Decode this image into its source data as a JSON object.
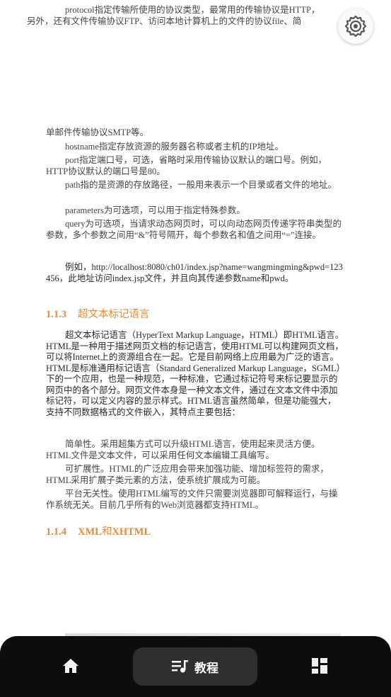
{
  "paragraphs": {
    "protocol_line1": "protocol指定传输所使用的协议类型，最常用的传输协议是HTTP，",
    "protocol_line2": "另外，还有文件传输协议FTP、访问本地计算机上的文件的协议file、简",
    "smtp": "单邮件传输协议SMTP等。",
    "hostname": "hostname指定存放资源的服务器名称或者主机的IP地址。",
    "port": "port指定端口号，可选，省略时采用传输协议默认的端口号。例如，HTTP协议默认的端口号是80。",
    "path": "path指的是资源的存放路径，一般用来表示一个目录或者文件的地址。",
    "parameters": "parameters为可选项，可以用于指定特殊参数。",
    "query": "query为可选项，当请求动态网页时，可以向动态网页传递字符串类型的参数，多个参数之间用“&”符号隔开，每个参数名和值之间用“=”连接。",
    "example": "例如，http://localhost:8080/ch01/index.jsp?name=wangmingming&pwd=123456，此地址访问index.jsp文件，并且向其传递参数name和pwd。",
    "html_intro": "超文本标记语言（HyperText Markup Language，HTML）即HTML语言。HTML是一种用于描述网页文档的标记语言，使用HTML可以构建网页文档，可以将Internet上的资源组合在一起。它是目前网络上应用最为广泛的语言。HTML是标准通用标记语言（Standard Generalized Markup Language，SGML）下的一个应用，也是一种规范，一种标准，它通过标记符号来标记要显示的网页中的各个部分。网页文件本身是一种文本文件，通过在文本文件中添加标记符，可以定义内容的显示样式。HTML语言虽然简单，但是功能强大，支持不同数据格式的文件嵌入，其特点主要包括：",
    "simplicity": "简单性。采用超集方式可以升级HTML语言，使用起来灵活方便。HTML文件是文本文件，可以采用任何文本编辑工具编写。",
    "extensibility": "可扩展性。HTML的广泛应用会带来加强功能、增加标签符的需求，HTML采用扩展子类元素的方法，使系统扩展成为可能。",
    "platform": "平台无关性。使用HTML编写的文件只需要浏览器即可解释运行，与操作系统无关。目前几乎所有的Web浏览器都支持HTML。"
  },
  "headings": {
    "h113_num": "1.1.3",
    "h113_title": "超文本标记语言",
    "h114_num": "1.1.4",
    "h114_xml": "XML",
    "h114_and": "和",
    "h114_xhtml": "XHTML"
  },
  "bottom_nav": {
    "tutorial_label": "教程",
    "home_icon": "home-icon",
    "tutorial_icon": "playlist-icon",
    "grid_icon": "dashboard-icon"
  },
  "colors": {
    "heading": "#e8893a",
    "bar": "#0d0d0d",
    "active_tab": "#2f2f2f"
  }
}
